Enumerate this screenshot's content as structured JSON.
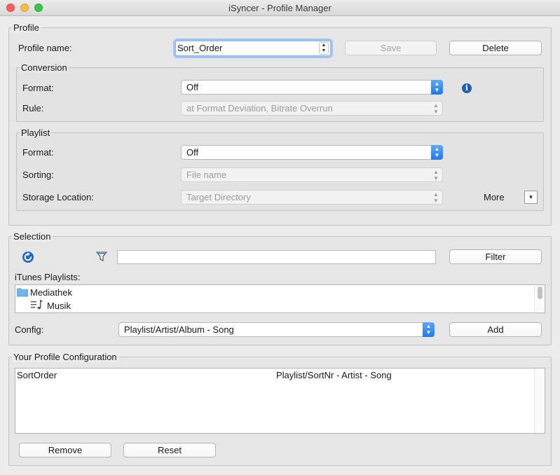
{
  "window": {
    "title": "iSyncer - Profile Manager"
  },
  "profile": {
    "legend": "Profile",
    "name_label": "Profile name:",
    "name_value": "Sort_Order",
    "save_label": "Save",
    "delete_label": "Delete",
    "conversion": {
      "legend": "Conversion",
      "format_label": "Format:",
      "format_value": "Off",
      "rule_label": "Rule:",
      "rule_value": "at Format Deviation, Bitrate Overrun"
    },
    "playlist": {
      "legend": "Playlist",
      "format_label": "Format:",
      "format_value": "Off",
      "sorting_label": "Sorting:",
      "sorting_value": "File name",
      "storage_label": "Storage Location:",
      "storage_value": "Target Directory",
      "more_label": "More"
    }
  },
  "selection": {
    "legend": "Selection",
    "filter_value": "",
    "filter_button": "Filter",
    "itunes_label": "iTunes Playlists:",
    "tree": [
      {
        "label": "Mediathek",
        "icon": "folder-icon"
      },
      {
        "label": "Musik",
        "icon": "music-playlist-icon"
      }
    ],
    "config_label": "Config:",
    "config_value": "Playlist/Artist/Album - Song",
    "add_label": "Add"
  },
  "your_profile": {
    "legend": "Your Profile Configuration",
    "rows": [
      {
        "name": "SortOrder",
        "value": "Playlist/SortNr - Artist - Song"
      }
    ],
    "remove_label": "Remove",
    "reset_label": "Reset"
  },
  "colors": {
    "accent": "#1b7af5",
    "info": "#1d5fb3",
    "folder": "#6fb6ef"
  }
}
